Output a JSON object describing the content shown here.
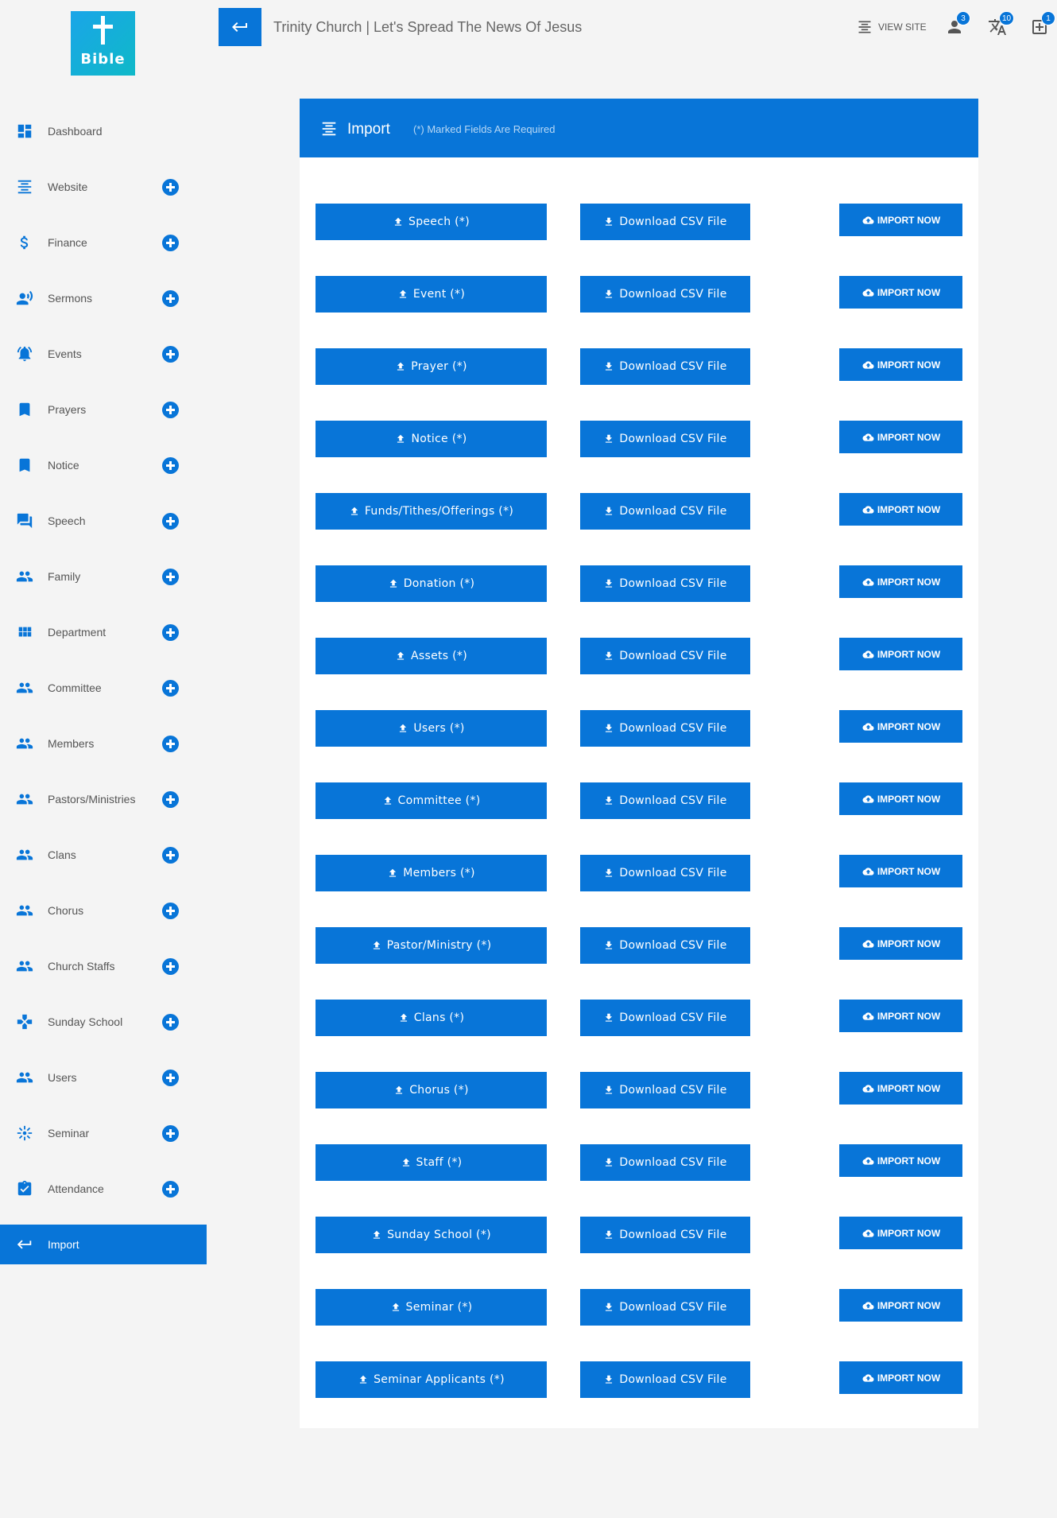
{
  "logo": {
    "text": "Bible"
  },
  "header": {
    "title": "Trinity Church | Let's Spread The News Of Jesus",
    "view_site": "VIEW SITE",
    "badges": {
      "user": "3",
      "translate": "10",
      "notifications": "1"
    }
  },
  "sidebar": {
    "items": [
      {
        "label": "Dashboard",
        "icon": "dashboard-icon",
        "plus": false
      },
      {
        "label": "Website",
        "icon": "website-icon",
        "plus": true
      },
      {
        "label": "Finance",
        "icon": "dollar-icon",
        "plus": true
      },
      {
        "label": "Sermons",
        "icon": "speaker-icon",
        "plus": true
      },
      {
        "label": "Events",
        "icon": "bell-icon",
        "plus": true
      },
      {
        "label": "Prayers",
        "icon": "bookmark-icon",
        "plus": true
      },
      {
        "label": "Notice",
        "icon": "bookmark-icon",
        "plus": true
      },
      {
        "label": "Speech",
        "icon": "chat-icon",
        "plus": true
      },
      {
        "label": "Family",
        "icon": "people-icon",
        "plus": true
      },
      {
        "label": "Department",
        "icon": "grid-icon",
        "plus": true
      },
      {
        "label": "Committee",
        "icon": "people-icon",
        "plus": true
      },
      {
        "label": "Members",
        "icon": "people-icon",
        "plus": true
      },
      {
        "label": "Pastors/Ministries",
        "icon": "people-icon",
        "plus": true
      },
      {
        "label": "Clans",
        "icon": "people-icon",
        "plus": true
      },
      {
        "label": "Chorus",
        "icon": "people-icon",
        "plus": true
      },
      {
        "label": "Church Staffs",
        "icon": "people-icon",
        "plus": true
      },
      {
        "label": "Sunday School",
        "icon": "gamepad-icon",
        "plus": true
      },
      {
        "label": "Users",
        "icon": "people-icon",
        "plus": true
      },
      {
        "label": "Seminar",
        "icon": "sun-icon",
        "plus": true
      },
      {
        "label": "Attendance",
        "icon": "clipboard-check-icon",
        "plus": true
      },
      {
        "label": "Import",
        "icon": "import-arrow-icon",
        "plus": false,
        "active": true
      }
    ]
  },
  "panel": {
    "title": "Import",
    "note": "(*) Marked Fields Are Required",
    "download_label": "Download CSV File",
    "import_label": "IMPORT NOW",
    "rows": [
      {
        "upload_label": "Speech (*)"
      },
      {
        "upload_label": "Event (*)"
      },
      {
        "upload_label": "Prayer (*)"
      },
      {
        "upload_label": "Notice (*)"
      },
      {
        "upload_label": "Funds/Tithes/Offerings (*)"
      },
      {
        "upload_label": "Donation (*)"
      },
      {
        "upload_label": "Assets (*)"
      },
      {
        "upload_label": "Users (*)"
      },
      {
        "upload_label": "Committee (*)"
      },
      {
        "upload_label": "Members (*)"
      },
      {
        "upload_label": "Pastor/Ministry (*)"
      },
      {
        "upload_label": "Clans (*)"
      },
      {
        "upload_label": "Chorus (*)"
      },
      {
        "upload_label": "Staff (*)"
      },
      {
        "upload_label": "Sunday School (*)"
      },
      {
        "upload_label": "Seminar (*)"
      },
      {
        "upload_label": "Seminar Applicants (*)"
      }
    ]
  },
  "colors": {
    "accent": "#0875d8",
    "background": "#f4f4f4",
    "panel": "#ffffff"
  }
}
